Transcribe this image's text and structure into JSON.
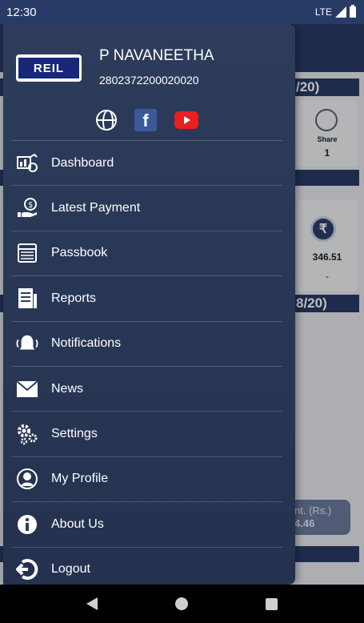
{
  "status_bar": {
    "time": "12:30",
    "network": "LTE"
  },
  "background": {
    "band1_text": "/20)",
    "band3_text": "8/20)",
    "share_label": "Share",
    "share_value": "1",
    "amount_value": "346.51",
    "amount_dash": "-",
    "pill_label": "nt. (Rs.)",
    "pill_value": "4.46"
  },
  "drawer": {
    "logo_text": "REIL",
    "user_name": "P NAVANEETHA",
    "user_id": "2802372200020020",
    "social": [
      "globe-icon",
      "facebook-icon",
      "youtube-icon"
    ],
    "menu": [
      {
        "label": "Dashboard",
        "icon": "dashboard-icon"
      },
      {
        "label": "Latest Payment",
        "icon": "payment-icon"
      },
      {
        "label": "Passbook",
        "icon": "passbook-icon"
      },
      {
        "label": "Reports",
        "icon": "reports-icon"
      },
      {
        "label": "Notifications",
        "icon": "bell-icon"
      },
      {
        "label": "News",
        "icon": "mail-icon"
      },
      {
        "label": "Settings",
        "icon": "gear-icon"
      },
      {
        "label": "My Profile",
        "icon": "profile-icon"
      },
      {
        "label": "About Us",
        "icon": "info-icon"
      },
      {
        "label": "Logout",
        "icon": "logout-icon"
      }
    ]
  }
}
